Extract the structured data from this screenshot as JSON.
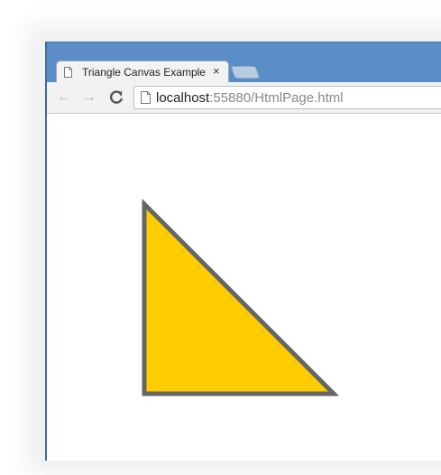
{
  "browser": {
    "tab": {
      "title": "Triangle Canvas Example",
      "close_glyph": "×",
      "icon": "document-icon"
    },
    "toolbar": {
      "back_glyph": "←",
      "forward_glyph": "→",
      "reload_glyph": "C",
      "url_host": "localhost",
      "url_rest": ":55880/HtmlPage.html"
    }
  },
  "canvas": {
    "shape": "triangle",
    "fill_color": "#ffcc00",
    "stroke_color": "#666666"
  }
}
